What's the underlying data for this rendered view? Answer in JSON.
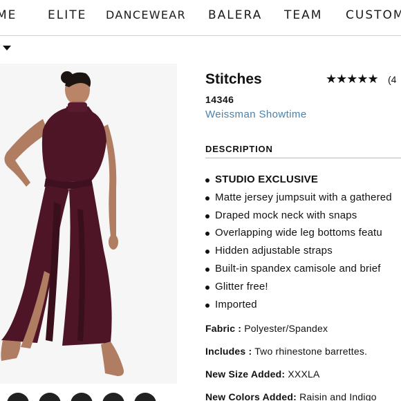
{
  "nav": {
    "items": [
      "IME",
      "ELITE",
      "DANCEWEAR",
      "BALERA",
      "TEAM",
      "CUSTOM"
    ]
  },
  "product": {
    "title": "Stitches",
    "rating": {
      "stars": "★★★★★",
      "count_text": "(4"
    },
    "sku": "14346",
    "brand": "Weissman Showtime",
    "garment_color": "#4d1526"
  },
  "description": {
    "heading": "DESCRIPTION",
    "bullets": [
      "STUDIO EXCLUSIVE",
      "Matte jersey jumpsuit with a gathered",
      "Draped mock neck with snaps",
      "Overlapping wide leg bottoms featu",
      "Hidden adjustable straps",
      "Built-in spandex camisole and brief",
      "Glitter free!",
      "Imported"
    ]
  },
  "specs": [
    {
      "label": "Fabric :",
      "value": " Polyester/Spandex"
    },
    {
      "label": "Includes :",
      "value": " Two rhinestone barrettes."
    },
    {
      "label": "New Size Added:",
      "value": " XXXLA"
    },
    {
      "label": "New Colors Added:",
      "value": " Raisin and Indigo"
    }
  ],
  "icons": {
    "caret": "caret-down-icon",
    "star": "star-icon"
  }
}
